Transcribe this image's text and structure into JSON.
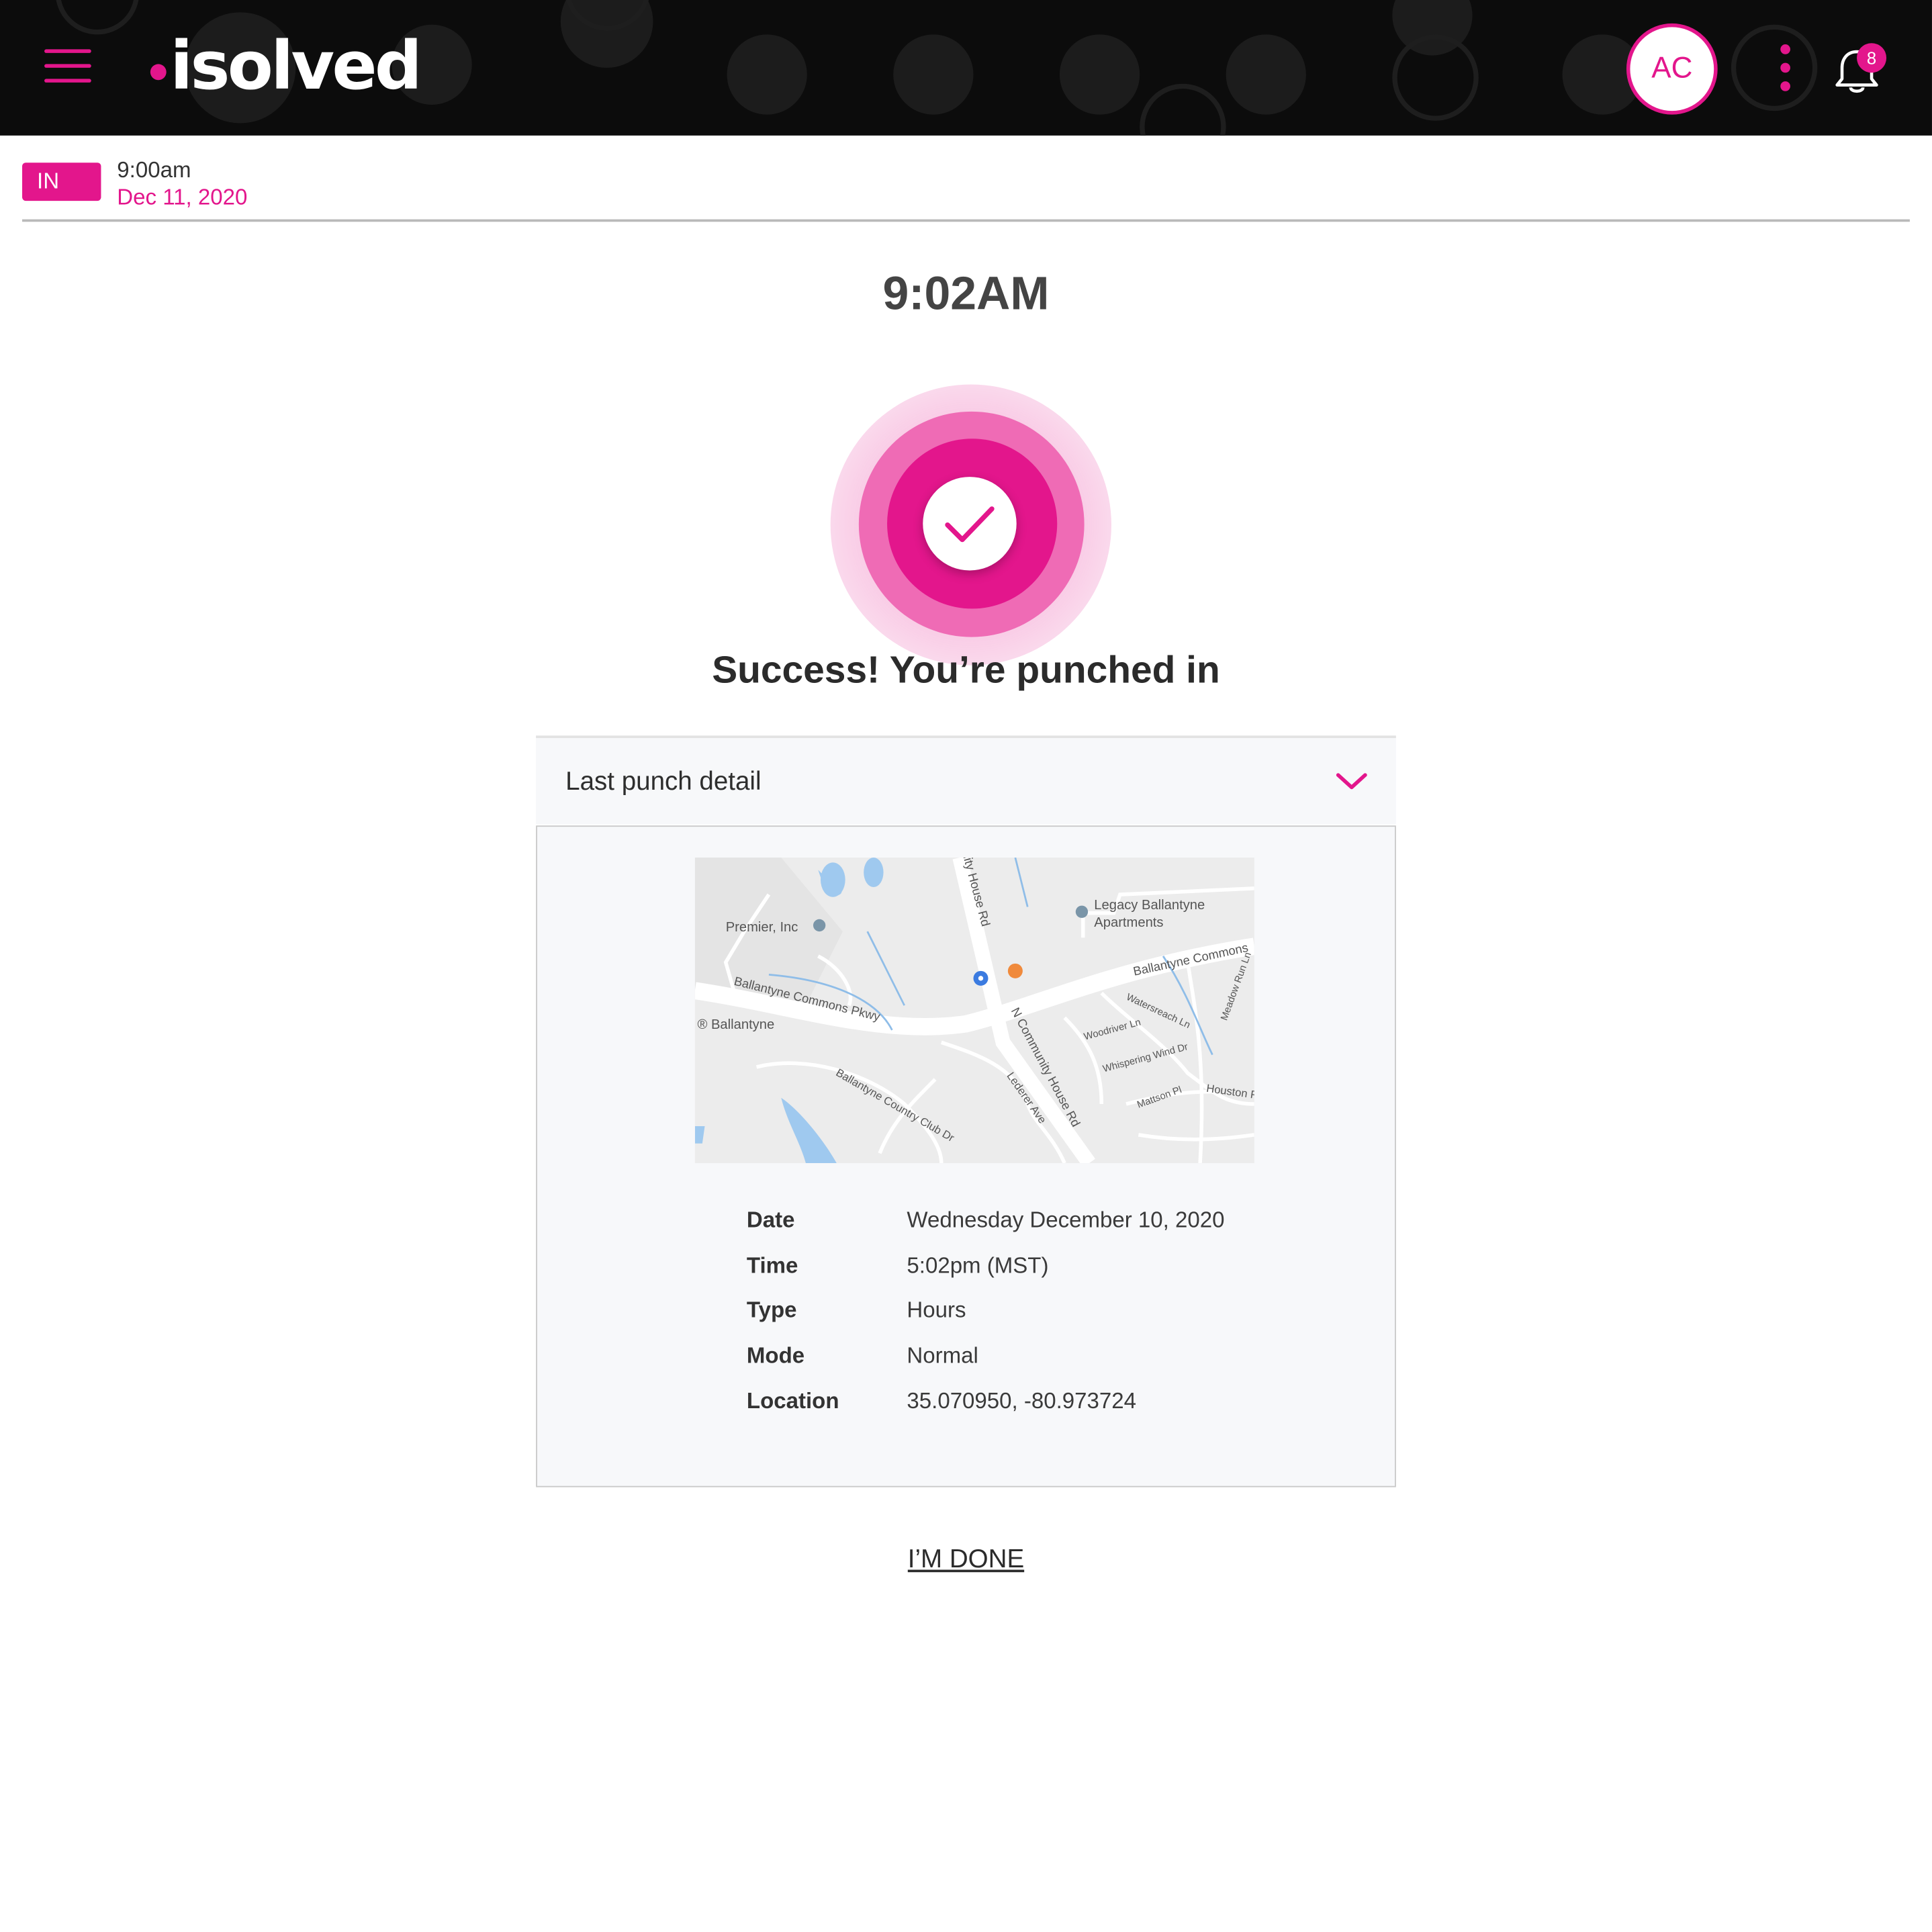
{
  "header": {
    "logo_text": "isolved",
    "trademark": "™",
    "avatar_initials": "AC",
    "notification_count": "8"
  },
  "status": {
    "tag": "IN",
    "time": "9:00am",
    "date": "Dec 11, 2020"
  },
  "main": {
    "clock": "9:02AM",
    "success_message": "Success! You’re punched in"
  },
  "panel": {
    "title": "Last punch detail",
    "map_labels": {
      "premier": "Premier, Inc",
      "legacy_1": "Legacy Ballantyne",
      "legacy_2": "Apartments",
      "ballantyne_commons": "Ballantyne Commons",
      "ballantyne_commons_pkwy": "Ballantyne Commons Pkwy",
      "ballantyne": "® Ballantyne",
      "community_house_rd": "N Community House Rd",
      "community_house_rd_top": "nity House Rd",
      "country_club_dr": "Ballantyne Country Club Dr",
      "lederer": "Lederer Ave",
      "woodriver": "Woodriver Ln",
      "whispering_wind": "Whispering Wind Dr",
      "watersreach": "Watersreach Ln",
      "mattson": "Mattson Pl",
      "houston": "Houston R",
      "meadow_run": "Meadow Run Ln"
    },
    "details": [
      {
        "label": "Date",
        "value": "Wednesday December 10, 2020"
      },
      {
        "label": "Time",
        "value": "5:02pm (MST)"
      },
      {
        "label": "Type",
        "value": "Hours"
      },
      {
        "label": "Mode",
        "value": "Normal"
      },
      {
        "label": "Location",
        "value": "35.070950,  -80.973724"
      }
    ]
  },
  "done_label": "I’M DONE",
  "colors": {
    "accent": "#e3168c",
    "header_bg": "#0c0c0c",
    "panel_bg": "#f7f8fa"
  }
}
